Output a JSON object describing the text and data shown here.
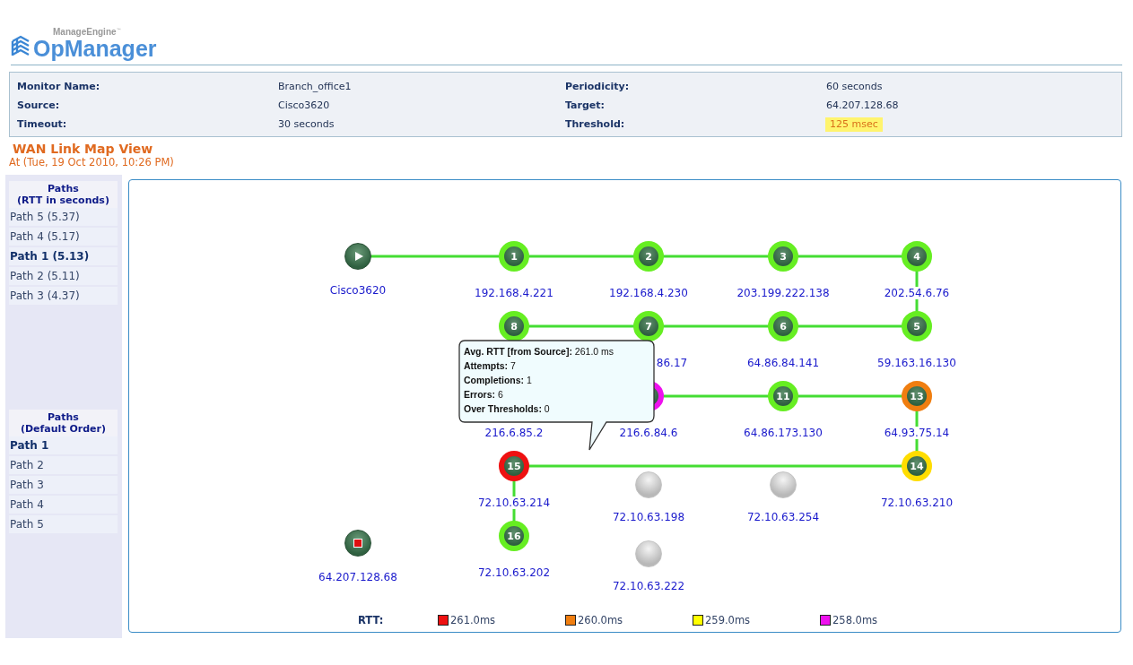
{
  "brand": {
    "company": "ManageEngine",
    "trademark": "™",
    "product": "OpManager"
  },
  "monitor": [
    {
      "label": "Monitor Name:",
      "value": "Branch_office1"
    },
    {
      "label": "Periodicity:",
      "value": "60 seconds"
    },
    {
      "label": "Source:",
      "value": "Cisco3620"
    },
    {
      "label": "Target:",
      "value": "64.207.128.68"
    },
    {
      "label": "Timeout:",
      "value": "30 seconds"
    },
    {
      "label": "Threshold:",
      "value": "125 msec",
      "highlighted": true
    }
  ],
  "view": {
    "title": "WAN Link Map View",
    "timestamp": "At (Tue, 19 Oct 2010, 10:26 PM)"
  },
  "sidebar": [
    {
      "heading": [
        "Paths",
        "(RTT in seconds)"
      ],
      "items": [
        {
          "label": "Path 5 (5.37)",
          "selected": false
        },
        {
          "label": "Path 4 (5.17)",
          "selected": false
        },
        {
          "label": "Path 1 (5.13)",
          "selected": true
        },
        {
          "label": "Path 2 (5.11)",
          "selected": false
        },
        {
          "label": "Path 3 (4.37)",
          "selected": false
        }
      ]
    },
    {
      "heading": [
        "Paths",
        "(Default Order)"
      ],
      "items": [
        {
          "label": "Path 1",
          "selected": true
        },
        {
          "label": "Path 2",
          "selected": false
        },
        {
          "label": "Path 3",
          "selected": false
        },
        {
          "label": "Path 4",
          "selected": false
        },
        {
          "label": "Path 5",
          "selected": false
        }
      ]
    }
  ],
  "map": {
    "nodes": [
      {
        "kind": "source",
        "label": "Cisco3620"
      },
      {
        "kind": "hop",
        "number": "1",
        "color": "#66ee22",
        "label": "192.168.4.221"
      },
      {
        "kind": "hop",
        "number": "2",
        "color": "#66ee22",
        "label": "192.168.4.230"
      },
      {
        "kind": "hop",
        "number": "3",
        "color": "#66ee22",
        "label": "203.199.222.138"
      },
      {
        "kind": "hop",
        "number": "4",
        "color": "#66ee22",
        "label": "202.54.6.76"
      },
      {
        "kind": "hop",
        "number": "8",
        "color": "#66ee22"
      },
      {
        "kind": "hop",
        "number": "7",
        "color": "#66ee22",
        "label": "86.17"
      },
      {
        "kind": "hop",
        "number": "6",
        "color": "#66ee22",
        "label": "64.86.84.141"
      },
      {
        "kind": "hop",
        "number": "5",
        "color": "#66ee22",
        "label": "59.163.16.130"
      },
      {
        "kind": "label",
        "label": "216.6.85.2"
      },
      {
        "kind": "hop",
        "color": "#ee11ee",
        "label": "216.6.84.6"
      },
      {
        "kind": "hop",
        "number": "11",
        "color": "#66ee22",
        "label": "64.86.173.130"
      },
      {
        "kind": "hop",
        "number": "13",
        "color": "#f07e10",
        "label": "64.93.75.14"
      },
      {
        "kind": "hop",
        "number": "15",
        "color": "#ee1111",
        "label": "72.10.63.214"
      },
      {
        "kind": "hop",
        "number": "14",
        "color": "#ffdd00",
        "label": "72.10.63.210"
      },
      {
        "kind": "inactive",
        "label": "72.10.63.198"
      },
      {
        "kind": "inactive",
        "label": "72.10.63.254"
      },
      {
        "kind": "target",
        "label": "64.207.128.68"
      },
      {
        "kind": "hop",
        "number": "16",
        "color": "#66ee22",
        "label": "72.10.63.202"
      },
      {
        "kind": "inactive",
        "label": "72.10.63.222"
      }
    ],
    "tooltip": [
      "**Avg. RTT [from Source]:** 261.0 ms",
      "**Attempts:** 7",
      "**Completions:** 1",
      "**Errors:** 6",
      "**Over Thresholds:** 0"
    ],
    "legend": {
      "title": "RTT:",
      "items": [
        {
          "color": "#ee1111",
          "label": "261.0ms"
        },
        {
          "color": "#f07e10",
          "label": "260.0ms"
        },
        {
          "color": "#ffff00",
          "label": "259.0ms"
        },
        {
          "color": "#ee11ee",
          "label": "258.0ms"
        }
      ]
    }
  }
}
